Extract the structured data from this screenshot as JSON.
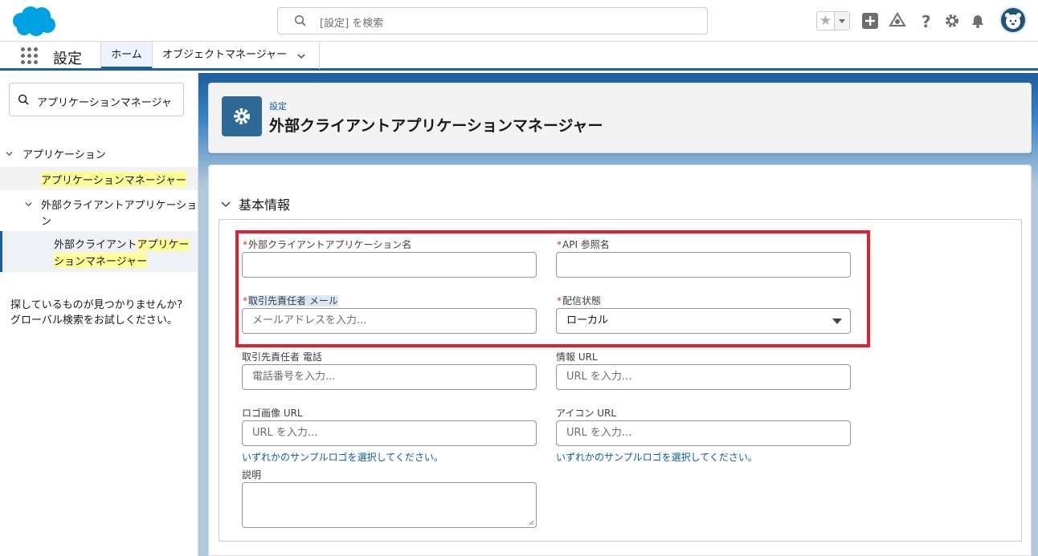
{
  "header": {
    "search_placeholder": "[設定] を検索",
    "icons": [
      "favorites-star-icon",
      "add-icon",
      "trailhead-icon",
      "help-icon",
      "setup-gear-icon",
      "notification-bell-icon",
      "avatar"
    ]
  },
  "nav": {
    "app_name": "設定",
    "tabs": [
      {
        "label": "ホーム"
      },
      {
        "label": "オブジェクトマネージャー"
      }
    ]
  },
  "sidebar": {
    "quickfind_value": "アプリケーションマネージャ",
    "tree": {
      "root": "アプリケーション",
      "item1": "アプリケーションマネージャー",
      "item2_line1": "外部クライアントアプリケーショ",
      "item2_line2": "ン",
      "item3_line1_a": "外部クライアント",
      "item3_line1_b": "アプリケー",
      "item3_line2": "ションマネージャー"
    },
    "help_line1": "探しているものが見つかりませんか?",
    "help_line2": "グローバル検索をお試しください。"
  },
  "page_header": {
    "breadcrumb": "設定",
    "title": "外部クライアントアプリケーションマネージャー"
  },
  "section": {
    "title": "基本情報"
  },
  "form": {
    "app_name_label": "外部クライアントアプリケーション名",
    "api_name_label": "API 参照名",
    "contact_email_label": "取引先責任者 メール",
    "contact_email_placeholder": "メールアドレスを入力...",
    "distribution_label": "配信状態",
    "distribution_value": "ローカル",
    "contact_phone_label": "取引先責任者 電話",
    "contact_phone_placeholder": "電話番号を入力...",
    "info_url_label": "情報 URL",
    "info_url_placeholder": "URL を入力...",
    "logo_url_label": "ロゴ画像 URL",
    "logo_url_placeholder": "URL を入力...",
    "icon_url_label": "アイコン URL",
    "icon_url_placeholder": "URL を入力...",
    "sample_logo_link": "いずれかのサンプルロゴを選択してください。",
    "description_label": "説明",
    "required_marker": "*"
  },
  "colors": {
    "brand_blue": "#1b5f9e",
    "highlight_yellow": "#ffff99",
    "required_red": "#c23934",
    "annotation_red": "#e0202e"
  }
}
